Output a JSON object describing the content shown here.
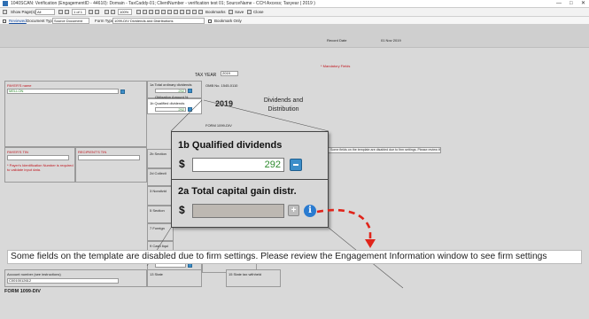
{
  "window": {
    "title": "1040SCAN: Verification (EngagementID - 44610): Domain - TaxCaddy-01; ClientNumber - verification test 01; SourceName - CCH Axcess; Taxyear ( 2019 )",
    "controls": [
      "—",
      "□",
      "✕"
    ]
  },
  "toolbar1": {
    "show_pages_label": "Show Page(s)",
    "show_pages_value": "All",
    "page_nav": "1 of 1",
    "zoom_value": "100%",
    "bookmarks_label": "Bookmarks",
    "save_label": "Save",
    "close_label": "Close"
  },
  "toolbar2": {
    "reviewed_label": "Reviewed",
    "document_type_label": "Document Type:",
    "document_type_value": "Source Document",
    "form_type_label": "Form Type:",
    "form_type_value": "1099-DIV Dividends and Distributions",
    "bookmark_only_label": "Bookmark Only"
  },
  "form_header": {
    "record_date_label": "Record Date",
    "record_date_value": "01 Nov 2019",
    "tax_year_label": "TAX YEAR",
    "tax_year_value": "2019",
    "mandatory_note": "* Mandatory Fields"
  },
  "form": {
    "payer_name_label": "PAYER'S name",
    "payer_name_value": "MELLON",
    "box1a_label": "1a Total ordinary dividends",
    "box1a_value": "292",
    "obligation_label": "Obligation Amount %",
    "box1b_label": "1b Qualified dividends",
    "box1b_value": "292",
    "box2a_label": "2a Total capital gain distr.",
    "omb_label": "OMB No. 1545-0110",
    "year_big": "2019",
    "form_name": "FORM 1099-DIV",
    "title_line1": "Dividends and",
    "title_line2": "Distribution",
    "payer_tin_label": "PAYER'S TIN",
    "recipient_tin_label": "RECIPIENT'S TIN",
    "payer_tin_note": "* Payer's Identification Number is required to validate input data.",
    "box2b_label": "2b Section",
    "box2d_label": "2d Collecti",
    "box3_label": "3 Nondivid",
    "box5_label": "5 Section",
    "box7_label": "7 Foreign",
    "box9_label": "9 Cash liqui",
    "box11_label": "11 Exempt interest dividends",
    "box12_label": "12 Specified private activity bond interest dividends",
    "account_label": "Account number (see instructions)",
    "account_value": "C0010012612",
    "box13_label": "13 State",
    "box15_label": "15 State tax withheld",
    "form_footer": "FORM 1099-DIV",
    "tooltip_small": "Some fields on the template are disabled due to firm settings. Please review the Engagement Information window to see firm settings."
  },
  "popup": {
    "box1b_label": "1b  Qualified dividends",
    "box1b_dollar": "$",
    "box1b_value": "292",
    "box2a_label": "2a  Total capital gain distr.",
    "box2a_dollar": "$",
    "box2a_value": "",
    "plus_glyph": "+",
    "info_glyph": "i"
  },
  "banner": {
    "text": "Some fields on the template are disabled due to firm settings. Please review the Engagement Information window to see firm settings"
  },
  "colors": {
    "accent_blue": "#3c8ec9",
    "arrow_red": "#e0241a",
    "value_green": "#2e8b2e"
  }
}
